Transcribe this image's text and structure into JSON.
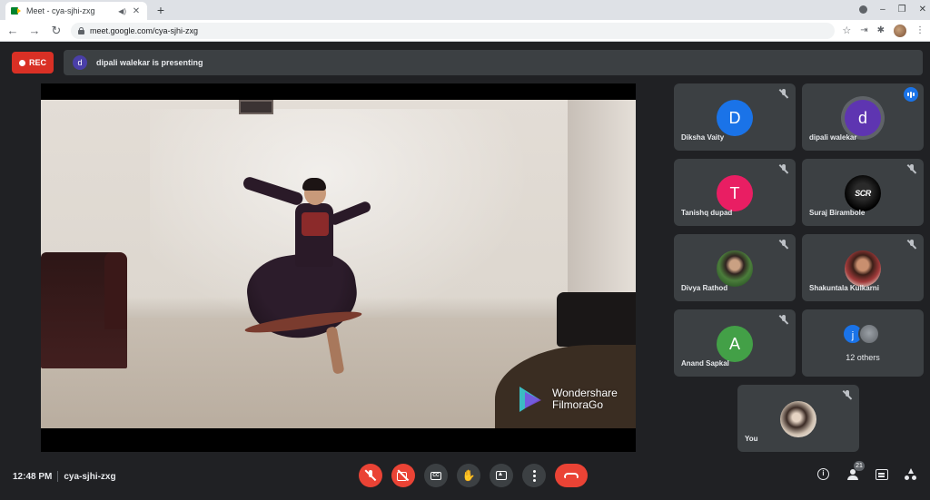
{
  "browser": {
    "tab_title": "Meet - cya-sjhi-zxg",
    "tab_close": "✕",
    "new_tab": "+",
    "url": "meet.google.com/cya-sjhi-zxg",
    "minimize": "–",
    "restore": "❐",
    "close": "✕"
  },
  "header": {
    "rec_label": "REC",
    "presenter_initial": "d",
    "presenting_text": "dipali walekar is presenting"
  },
  "video": {
    "watermark_line1": "Wondershare",
    "watermark_line2": "FilmoraGo"
  },
  "participants": [
    {
      "name": "Diksha Vaity",
      "initial": "D",
      "color": "#1a73e8",
      "muted": true
    },
    {
      "name": "dipali walekar",
      "initial": "d",
      "color": "#5e35b1",
      "muted": false,
      "speaking": true
    },
    {
      "name": "Tanishq dupad",
      "initial": "T",
      "color": "#e91e63",
      "muted": true
    },
    {
      "name": "Suraj Birambole",
      "initial": "SCR",
      "muted": true
    },
    {
      "name": "Divya Rathod",
      "muted": true
    },
    {
      "name": "Shakuntala Kulkarni",
      "muted": true
    },
    {
      "name": "Anand Sapkal",
      "initial": "A",
      "color": "#43a047",
      "muted": true
    },
    {
      "name": "You",
      "muted": true
    }
  ],
  "others_tile": {
    "initial": "j",
    "color": "#1a73e8",
    "label": "12 others"
  },
  "bottom": {
    "time": "12:48 PM",
    "meeting_code": "cya-sjhi-zxg",
    "cc_label": "CC",
    "people_count": "21",
    "info_label": "i"
  },
  "colors": {
    "background": "#202124",
    "tile": "#3c4043",
    "danger": "#ea4335",
    "accent": "#1a73e8"
  }
}
